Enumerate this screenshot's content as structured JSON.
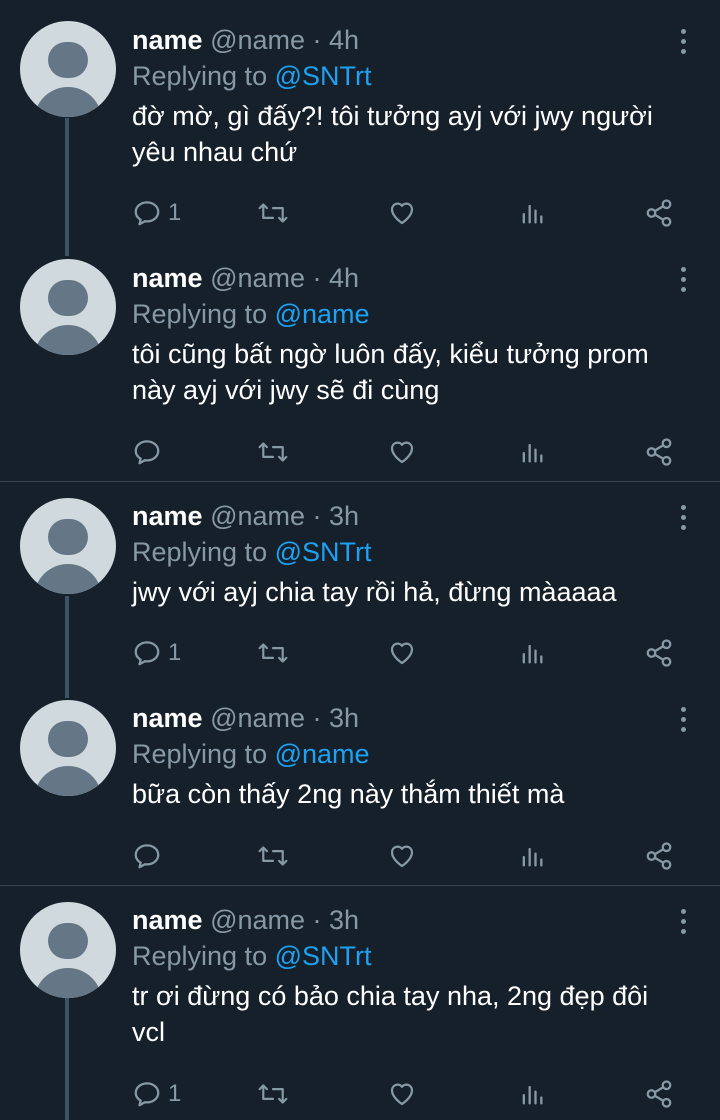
{
  "colors": {
    "background": "#15202b",
    "muted": "#8899a6",
    "accent": "#1da1f2",
    "divider": "#38444d"
  },
  "icons": [
    "avatar-placeholder",
    "more-vertical-icon",
    "reply-icon",
    "retweet-icon",
    "like-icon",
    "analytics-icon",
    "share-icon"
  ],
  "tweets": [
    {
      "name": "name",
      "handle": "@name",
      "time": "· 4h",
      "replying_prefix": "Replying to",
      "mention": "@SNTrt",
      "text": "đờ mờ, gì đấy?! tôi tưởng ayj với jwy người yêu nhau chứ",
      "reply_count": "1"
    },
    {
      "name": "name",
      "handle": "@name",
      "time": "· 4h",
      "replying_prefix": "Replying to",
      "mention": "@name",
      "text": "tôi cũng bất ngờ luôn đấy, kiểu tưởng prom này ayj với jwy sẽ đi cùng",
      "reply_count": ""
    },
    {
      "name": "name",
      "handle": "@name",
      "time": "· 3h",
      "replying_prefix": "Replying to",
      "mention": "@SNTrt",
      "text": "jwy với ayj chia tay rồi hả, đừng màaaaa",
      "reply_count": "1"
    },
    {
      "name": "name",
      "handle": "@name",
      "time": "· 3h",
      "replying_prefix": "Replying to",
      "mention": "@name",
      "text": "bữa còn thấy 2ng này thắm thiết mà",
      "reply_count": ""
    },
    {
      "name": "name",
      "handle": "@name",
      "time": "· 3h",
      "replying_prefix": "Replying to",
      "mention": "@SNTrt",
      "text": "tr ơi đừng có bảo chia tay nha, 2ng đẹp đôi vcl",
      "reply_count": "1"
    }
  ]
}
